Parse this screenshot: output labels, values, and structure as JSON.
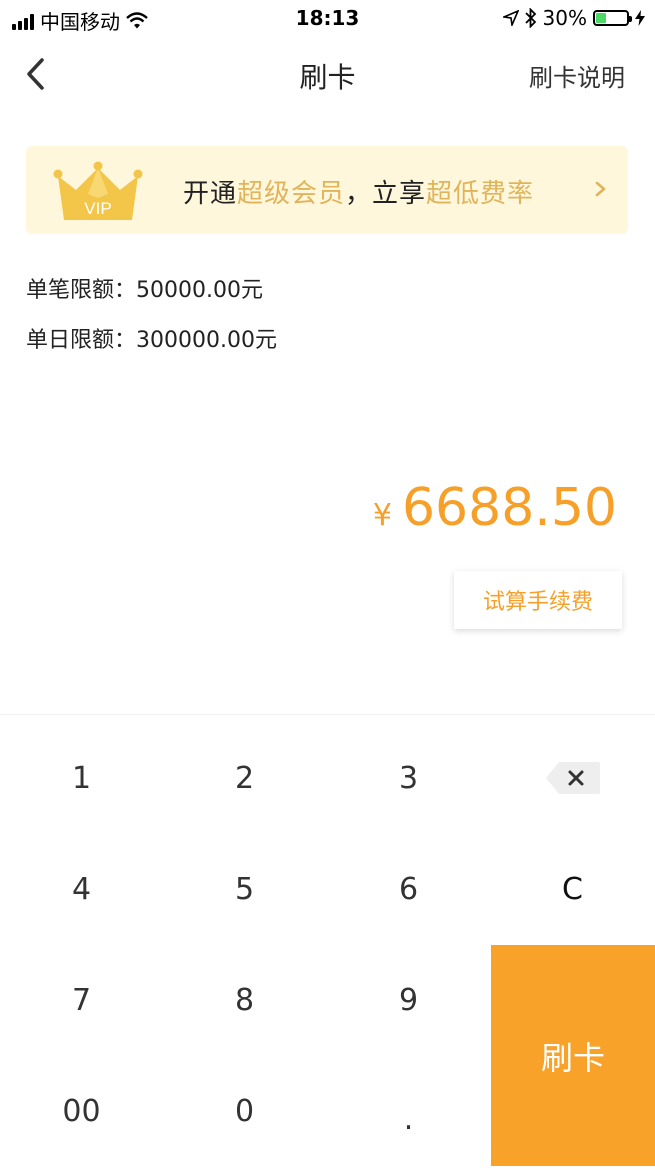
{
  "status_bar": {
    "carrier": "中国移动",
    "time": "18:13",
    "battery": "30%",
    "battery_level": 0.3,
    "icons": [
      "signal-icon",
      "wifi-icon",
      "location-icon",
      "bluetooth-icon",
      "battery-icon",
      "charging-icon"
    ]
  },
  "nav": {
    "title": "刷卡",
    "right_label": "刷卡说明",
    "back_icon": "back-chevron-icon"
  },
  "vip_banner": {
    "badge": "VIP",
    "text_parts": [
      "开通",
      "超级会员",
      "，立享",
      "超低费率"
    ],
    "highlight_color": "#e0b45a",
    "background_color": "#fff7dc"
  },
  "limits": {
    "single": "单笔限额：50000.00元",
    "daily": "单日限额：300000.00元"
  },
  "amount": {
    "currency": "¥",
    "value": "6688.50",
    "color": "#f6a02a"
  },
  "fee_button": "试算手续费",
  "keypad": {
    "keys": [
      "1",
      "2",
      "3",
      "4",
      "5",
      "6",
      "C",
      "7",
      "8",
      "9",
      "00",
      "0",
      "."
    ],
    "delete_icon": "backspace-icon",
    "submit": "刷卡",
    "submit_color": "#f9a229"
  }
}
